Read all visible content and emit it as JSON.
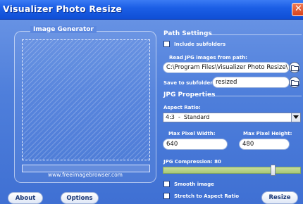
{
  "window": {
    "title": "Visualizer Photo Resize",
    "close_glyph": "✕"
  },
  "left": {
    "group_title": "Image Generator",
    "website": "www.freeimagebrowser.com",
    "progress": 0
  },
  "buttons": {
    "about": "About",
    "options": "Options",
    "resize": "Resize"
  },
  "path_settings": {
    "heading": "Path Settings",
    "include_subfolders": {
      "label": "Include subfolders",
      "checked": false
    },
    "read_label": "Read JPG images from path:",
    "read_path": "C:\\Program Files\\Visualizer Photo Resize\\",
    "save_label": "Save to subfolder:",
    "save_folder": "resized"
  },
  "jpg_properties": {
    "heading": "JPG Properties",
    "aspect_label": "Aspect Ratio:",
    "aspect_value": "4:3  -  Standard",
    "max_width_label": "Max Pixel Width:",
    "max_width": "640",
    "max_height_label": "Max Pixel Height:",
    "max_height": "480",
    "compression_label": "JPG Compression: 80",
    "compression": 80,
    "smooth_image": {
      "label": "Smooth image",
      "checked": false
    },
    "stretch": {
      "label": "Stretch to Aspect Ratio",
      "checked": false
    }
  },
  "icons": {
    "browse_read": "folder-icon",
    "browse_save": "folder-icon",
    "dropdown": "chevron-down-icon",
    "close": "close-icon"
  },
  "colors": {
    "titlebar": "#1c5fe6",
    "window_bg": "#4f7fdb",
    "close_button": "#d8421c",
    "slider_track": "#a9c877"
  }
}
